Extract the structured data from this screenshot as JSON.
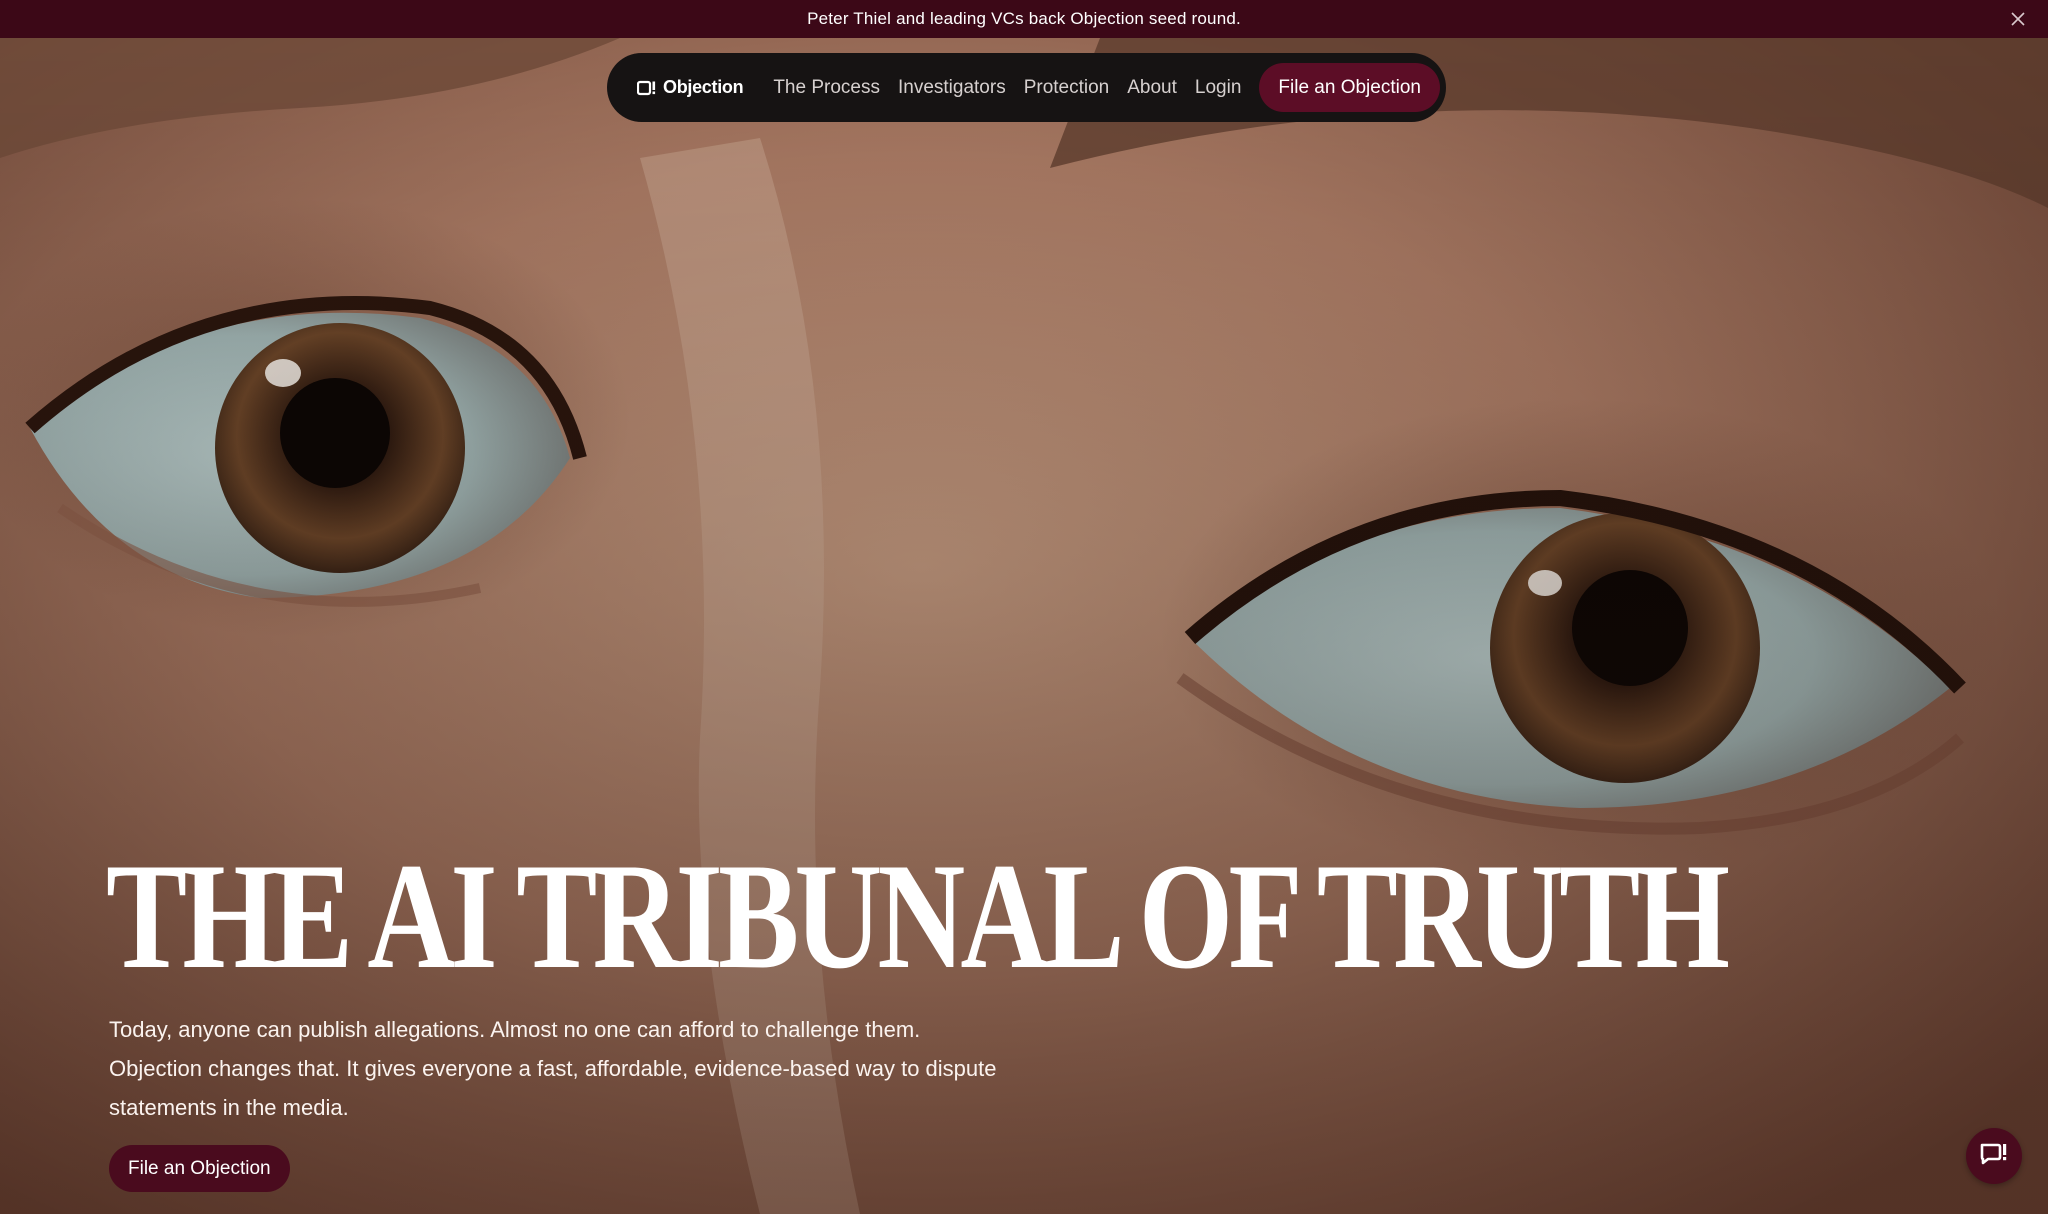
{
  "announcement": {
    "text": "Peter Thiel and leading VCs back Objection seed round.",
    "close_icon": "close-icon"
  },
  "nav": {
    "logo_text": "Objection",
    "logo_icon": "objection-logo-icon",
    "links": [
      {
        "label": "The Process"
      },
      {
        "label": "Investigators"
      },
      {
        "label": "Protection"
      },
      {
        "label": "About"
      },
      {
        "label": "Login"
      }
    ],
    "cta_label": "File an Objection"
  },
  "hero": {
    "headline": "THE AI TRIBUNAL OF TRUTH",
    "subtext_lines": [
      "Today, anyone can publish allegations. Almost no one can afford to challenge them.",
      "Objection changes that. It gives everyone a fast, affordable, evidence-based way to dispute",
      "statements in the media."
    ],
    "cta_label": "File an Objection",
    "chat_icon": "chat-bubble-icon"
  },
  "colors": {
    "brand": "#4a0b1e",
    "announcement_bg": "#3c0817",
    "nav_bg": "#161313"
  }
}
